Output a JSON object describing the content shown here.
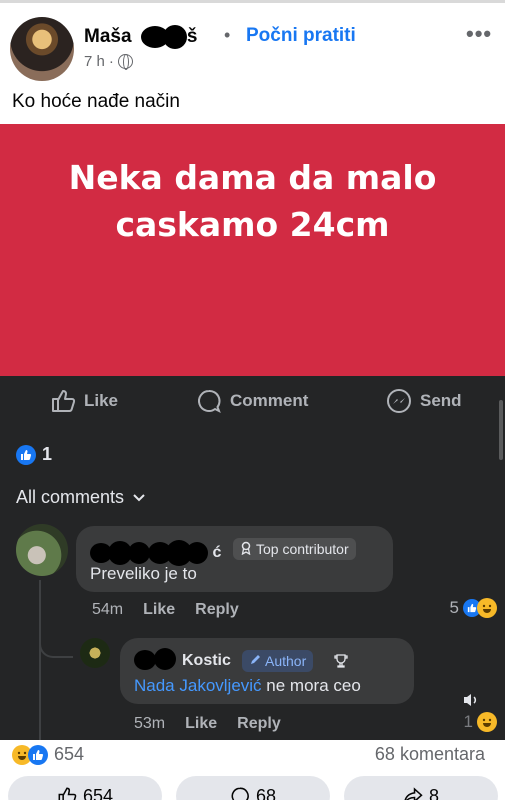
{
  "post": {
    "author_visible": "Maša",
    "author_trailing": "š",
    "separator": "•",
    "follow_label": "Počni pratiti",
    "more_label": "•••",
    "time": "7 h",
    "meta_dot": "·",
    "text": "Ko hoće nađe način",
    "banner_line1": "Neka dama da malo",
    "banner_line2": "caskamo 24cm"
  },
  "actions": {
    "like": "Like",
    "comment": "Comment",
    "send": "Send"
  },
  "reactions": {
    "count": "1"
  },
  "comments_header": "All comments",
  "comments": [
    {
      "name_visible": "ć",
      "badge": "Top contributor",
      "text": "Preveliko je to",
      "time": "54m",
      "like": "Like",
      "reply": "Reply",
      "reaction_count": "5"
    },
    {
      "name_visible": "Kostic",
      "badge": "Author",
      "mention": "Nada Jakovljević",
      "text": " ne mora ceo",
      "time": "53m",
      "like": "Like",
      "reply": "Reply",
      "reaction_count": "1"
    }
  ],
  "footer": {
    "reaction_total": "654",
    "comments_total": "68 komentara",
    "like_count": "654",
    "comment_count": "68",
    "share_count": "8"
  },
  "colors": {
    "banner": "#d22b43",
    "dark_bg": "#242526",
    "bubble": "#3a3b3c",
    "link": "#1877f2"
  }
}
